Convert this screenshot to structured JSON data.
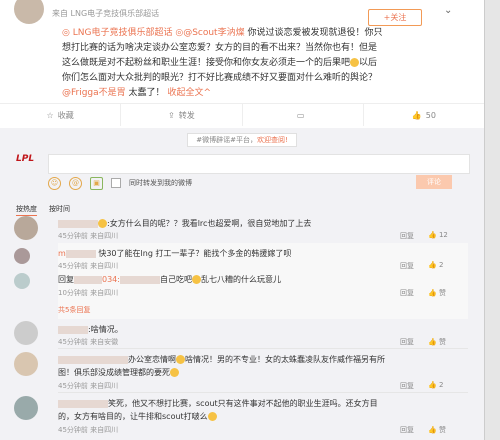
{
  "post": {
    "meta": "来自 LNG电子竞技俱乐部超话",
    "follow_label": "+关注",
    "line1_tag": "LNG电子竞技俱乐部超话",
    "line1_mention": "@Scout李汭燦",
    "line1_text": "你说过谈恋爱被发现就退役！你只",
    "line2": "想打比赛的话为啥决定谈办公室恋爱？女方的目的看不出来？当然你也有！但是",
    "line3": "这么做既是对不起粉丝和职业生涯！接受你和你女友必须走一个的后果吧",
    "line3_end": "以后",
    "line4": "你们怎么面对大众批判的眼光？打不好比赛成绩不好又要面对什么难听的舆论？",
    "line5_mention": "@Frigga不是胃",
    "line5_text": "太蠢了！",
    "collapse": "收起全文",
    "actions": [
      {
        "icon": "star-icon",
        "label": "收藏"
      },
      {
        "icon": "forward-icon",
        "label": "转发"
      },
      {
        "icon": "comment-icon",
        "label": ""
      },
      {
        "icon": "thumb-icon",
        "label": "50"
      }
    ]
  },
  "tagline": {
    "text": "#微博辟谣#平台，",
    "link": "欢迎查阅!"
  },
  "composer": {
    "logo": "LPL",
    "check_label": "同时转发到我的微博",
    "submit_label": "评论"
  },
  "sort": {
    "hot": "按热度",
    "time": "按时间"
  },
  "comments": [
    {
      "text": ":女方什么目的呢？？我看lrc也超爱啊，很自觉地加了上去",
      "meta": "45分钟前  来自四川",
      "reply_label": "回复",
      "likes": "12"
    },
    {
      "reply_user": "m",
      "reply_text": "快30了能在lng 打工一辈子？能找个多金的韩援嫁了呗",
      "reply_meta": "45分钟前  来自四川",
      "reply_label": "回复",
      "likes": "2"
    },
    {
      "reply_user": "回复",
      "reply_tag": "034:",
      "reply_text": "自己吃吧",
      "reply_text2": "乱七八糟的什么玩意儿",
      "reply_meta": "10分钟前  来自四川",
      "reply_label": "回复",
      "likes": "赞"
    },
    {
      "more": "共5条回复"
    },
    {
      "text": ":啥情况。",
      "meta": "45分钟前  来自安徽",
      "reply_label": "回复",
      "likes": "赞"
    },
    {
      "text": "办公室恋情啊",
      "text_b": "啥情况！男的不专业！女的太蛛蠢凌队友作威作福另有所",
      "text2": "图！俱乐部没成绩管理都的要死",
      "meta": "45分钟前  来自四川",
      "reply_label": "回复",
      "likes": "2"
    },
    {
      "text": "笑死，他又不想打比赛，scout只有这件事对不起他的职业生涯吗。还女方目",
      "text2": "的，女方有啥目的，让牛排和scout打啵么",
      "meta": "45分钟前  来自四川",
      "reply_label": "回复",
      "likes": "赞"
    }
  ]
}
